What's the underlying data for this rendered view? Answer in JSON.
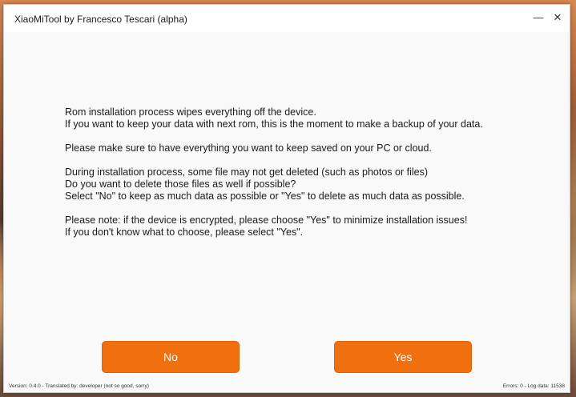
{
  "window": {
    "title": "XiaoMiTool by Francesco Tescari (alpha)",
    "minimize_glyph": "—",
    "close_glyph": "✕"
  },
  "message": {
    "paragraphs": [
      [
        "Rom installation process wipes everything off the device.",
        "If you want to keep your data with next rom, this is the moment to make a backup of your data."
      ],
      [
        "Please make sure to have everything you want to keep saved on your PC or cloud."
      ],
      [
        "During installation process, some file may not get deleted (such as photos or files)",
        "Do you want to delete those files as well if possible?",
        "Select \"No\" to keep as much data as possible or \"Yes\" to delete as much data as possible."
      ],
      [
        "Please note: if the device is encrypted, please choose \"Yes\" to minimize installation issues!",
        "If you don't know what to choose, please select \"Yes\"."
      ]
    ]
  },
  "buttons": {
    "no_label": "No",
    "yes_label": "Yes"
  },
  "footer": {
    "left": "Version: 0.4.0 - Translated by: developer (not so good, sorry)",
    "right": "Errors: 0 - Log data: 11538"
  },
  "colors": {
    "button": "#f06f0f",
    "window_bg": "#f9f9f9"
  },
  "icons": [
    "minimize-icon",
    "close-icon"
  ]
}
